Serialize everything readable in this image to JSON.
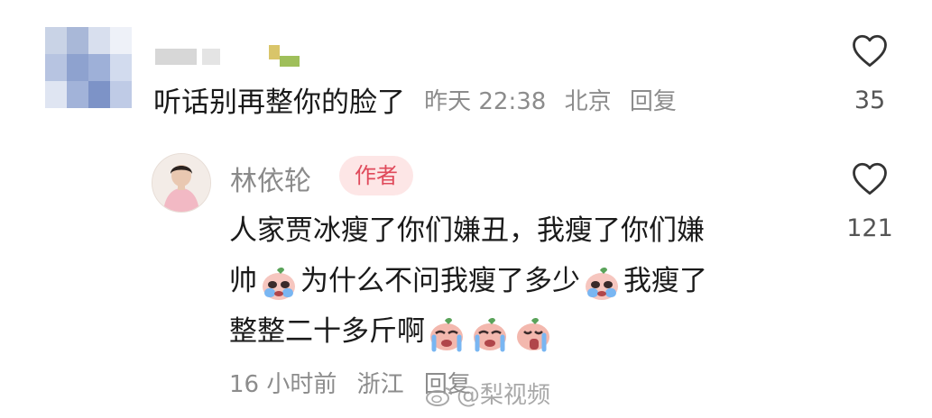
{
  "comment_main": {
    "text": "听话别再整你的脸了",
    "time": "昨天 22:38",
    "location": "北京",
    "reply_label": "回复",
    "like_count": "35"
  },
  "reply": {
    "author": "林依轮",
    "badge": "作者",
    "line1": "人家贾冰瘦了你们嫌丑，我瘦了你们嫌",
    "line2_a": "帅",
    "line2_b": "为什么不问我瘦了多少",
    "line2_c": "我瘦了",
    "line3": "整整二十多斤啊",
    "time": "16 小时前",
    "location": "浙江",
    "reply_label": "回复",
    "like_count": "121"
  },
  "watermark": {
    "text": "@梨视频"
  },
  "colors": {
    "badge_bg": "#fde6e6",
    "badge_text": "#e04a5b",
    "meta_text": "#8c8c8c"
  }
}
